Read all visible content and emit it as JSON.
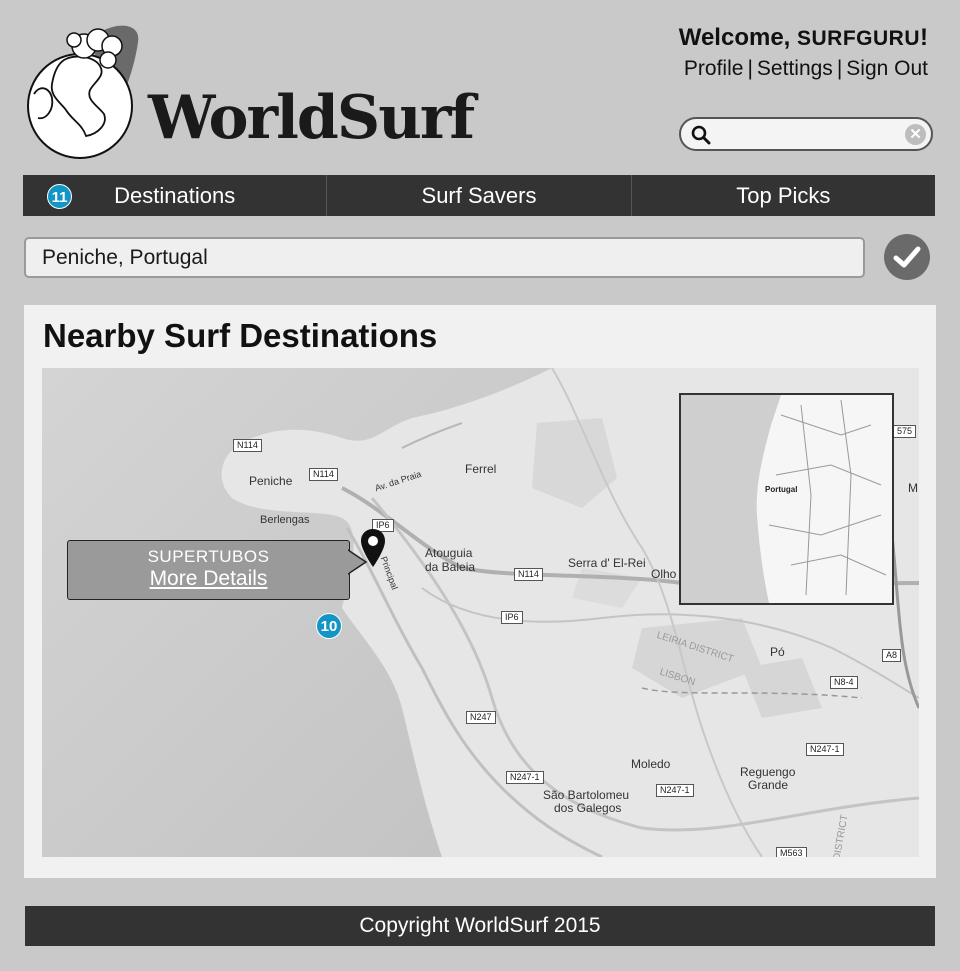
{
  "header": {
    "logo_text": "WorldSurf",
    "welcome_prefix": "Welcome, ",
    "username": "SURFGURU",
    "welcome_suffix": "!",
    "links": {
      "profile": "Profile",
      "settings": "Settings",
      "sign_out": "Sign Out"
    },
    "separator": "|"
  },
  "search": {
    "value": "",
    "placeholder": ""
  },
  "nav": {
    "items": [
      {
        "label": "Destinations",
        "badge": "11"
      },
      {
        "label": "Surf Savers"
      },
      {
        "label": "Top Picks"
      }
    ]
  },
  "location": {
    "value": "Peniche, Portugal"
  },
  "panel": {
    "title": "Nearby Surf Destinations"
  },
  "map": {
    "callout": {
      "destination": "SUPERTUBOS",
      "link": "More Details"
    },
    "cluster_badge": "10",
    "places": [
      "Peniche",
      "Berlengas",
      "Ferrel",
      "Atouguia",
      "da Baleia",
      "Serra d' El-Rei",
      "Olho",
      "Pó",
      "Moledo",
      "Reguengo",
      "Grande",
      "São Bartolomeu",
      "dos Galegos",
      "Av. da Praia",
      "Principal",
      "LEIRIA DISTRICT",
      "LISBON",
      "DISTRICT",
      "M"
    ],
    "roads": [
      "N114",
      "N114",
      "IP6",
      "N114",
      "IP6",
      "N247",
      "N247-1",
      "N247-1",
      "N247-1",
      "N8-4",
      "A8",
      "575",
      "M563"
    ],
    "inset": {
      "label": "Portugal"
    }
  },
  "footer": {
    "copyright": "Copyright WorldSurf 2015"
  },
  "colors": {
    "nav_bg": "#333333",
    "badge": "#1396c6",
    "page_bg": "#c9c9c9"
  }
}
